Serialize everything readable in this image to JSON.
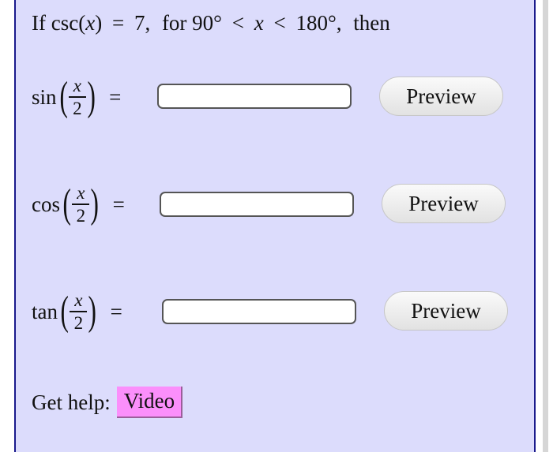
{
  "problem": {
    "prefix": "If",
    "func": "csc",
    "var": "x",
    "equals": "=",
    "value": "7,",
    "condition_prefix": "for",
    "lower": "90°",
    "lt": "<",
    "upper": "180°,",
    "suffix": "then"
  },
  "rows": [
    {
      "func": "sin",
      "numerator": "x",
      "denominator": "2",
      "equals": "=",
      "answer_value": "",
      "preview_label": "Preview"
    },
    {
      "func": "cos",
      "numerator": "x",
      "denominator": "2",
      "equals": "=",
      "answer_value": "",
      "preview_label": "Preview"
    },
    {
      "func": "tan",
      "numerator": "x",
      "denominator": "2",
      "equals": "=",
      "answer_value": "",
      "preview_label": "Preview"
    }
  ],
  "help": {
    "label": "Get help:",
    "video_label": "Video"
  },
  "colors": {
    "panel_bg": "#dcdcfc",
    "panel_border": "#1a1a8c",
    "video_bg": "#fb8ffb"
  }
}
